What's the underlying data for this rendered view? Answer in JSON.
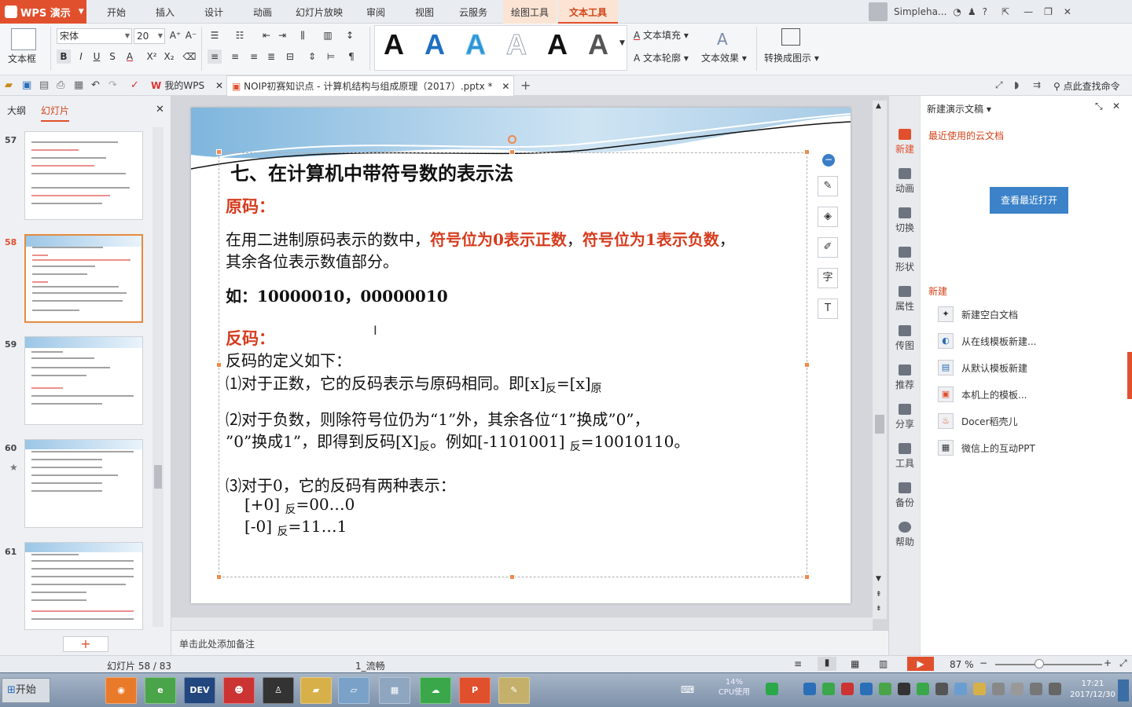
{
  "app": {
    "name": "WPS 演示"
  },
  "menu_tabs": [
    "开始",
    "插入",
    "设计",
    "动画",
    "幻灯片放映",
    "审阅",
    "视图",
    "云服务",
    "绘图工具",
    "文本工具"
  ],
  "user": {
    "name": "Simpleha..."
  },
  "ribbon": {
    "textbox_label": "文本框",
    "font_name": "宋体",
    "font_size": "20",
    "text_fill": "文本填充",
    "text_outline": "文本轮廓",
    "text_effect": "文本效果",
    "convert_label": "转换成图示",
    "style_letter": "A"
  },
  "doc_tabs": {
    "home": "我的WPS",
    "file": "NOIP初赛知识点 - 计算机结构与组成原理（2017）.pptx *",
    "search": "点此查找命令"
  },
  "left_panel": {
    "outline_tab": "大纲",
    "slides_tab": "幻灯片",
    "thumbs": [
      "57",
      "58",
      "59",
      "60",
      "61"
    ]
  },
  "slide": {
    "title": "七、在计算机中带符号数的表示法",
    "yuanma_head": "原码：",
    "line1_a": "在用二进制原码表示的数中，",
    "line1_b": "符号位为0表示正数",
    "line1_c": "，",
    "line1_d": "符号位为1表示负数",
    "line1_e": "，",
    "line2": "其余各位表示数值部分。",
    "example": "如：10000010，00000010",
    "fanma_head": "反码：",
    "def": "反码的定义如下：",
    "p1_a": "⑴对于正数，它的反码表示与原码相同。即[x]",
    "p1_sub1": "反",
    "p1_b": "=[x]",
    "p1_sub2": "原",
    "p2_line1": "⑵对于负数，则除符号位仍为“1”外，其余各位“1”换成”0”，",
    "p2_a": " ”0”换成1”，即得到反码[X]",
    "p2_sub1": "反",
    "p2_b": "。例如[-1101001] ",
    "p2_sub2": "反",
    "p2_c": "=10010110。",
    "p3": "⑶对于0，它的反码有两种表示：",
    "z1_a": "[+0] ",
    "z1_sub": "反",
    "z1_b": "=00…0",
    "z2_a": "[-0] ",
    "z2_sub": "反",
    "z2_b": "=11…1"
  },
  "notes_placeholder": "单击此处添加备注",
  "right_icons": [
    "新建",
    "动画",
    "切换",
    "形状",
    "属性",
    "传图",
    "推荐",
    "分享",
    "工具",
    "备份",
    "帮助"
  ],
  "right_panel": {
    "title": "新建演示文稿",
    "recent_link": "最近使用的云文档",
    "open_recent": "查看最近打开",
    "new_section": "新建",
    "items": [
      "新建空白文档",
      "从在线模板新建...",
      "从默认模板新建",
      "本机上的模板...",
      "Docer稻壳儿",
      "微信上的互动PPT"
    ]
  },
  "status": {
    "slide_info": "幻灯片 58 / 83",
    "theme": "1_流畅",
    "zoom": "87 %"
  },
  "taskbar": {
    "start": "开始",
    "cpu": "14%",
    "cpu_label": "CPU使用",
    "time": "17:21",
    "date": "2017/12/30",
    "dev_label": "DEV"
  },
  "colors": {
    "accent": "#e1502d",
    "slide_red": "#d63c1e",
    "button_blue": "#3b82c9"
  }
}
